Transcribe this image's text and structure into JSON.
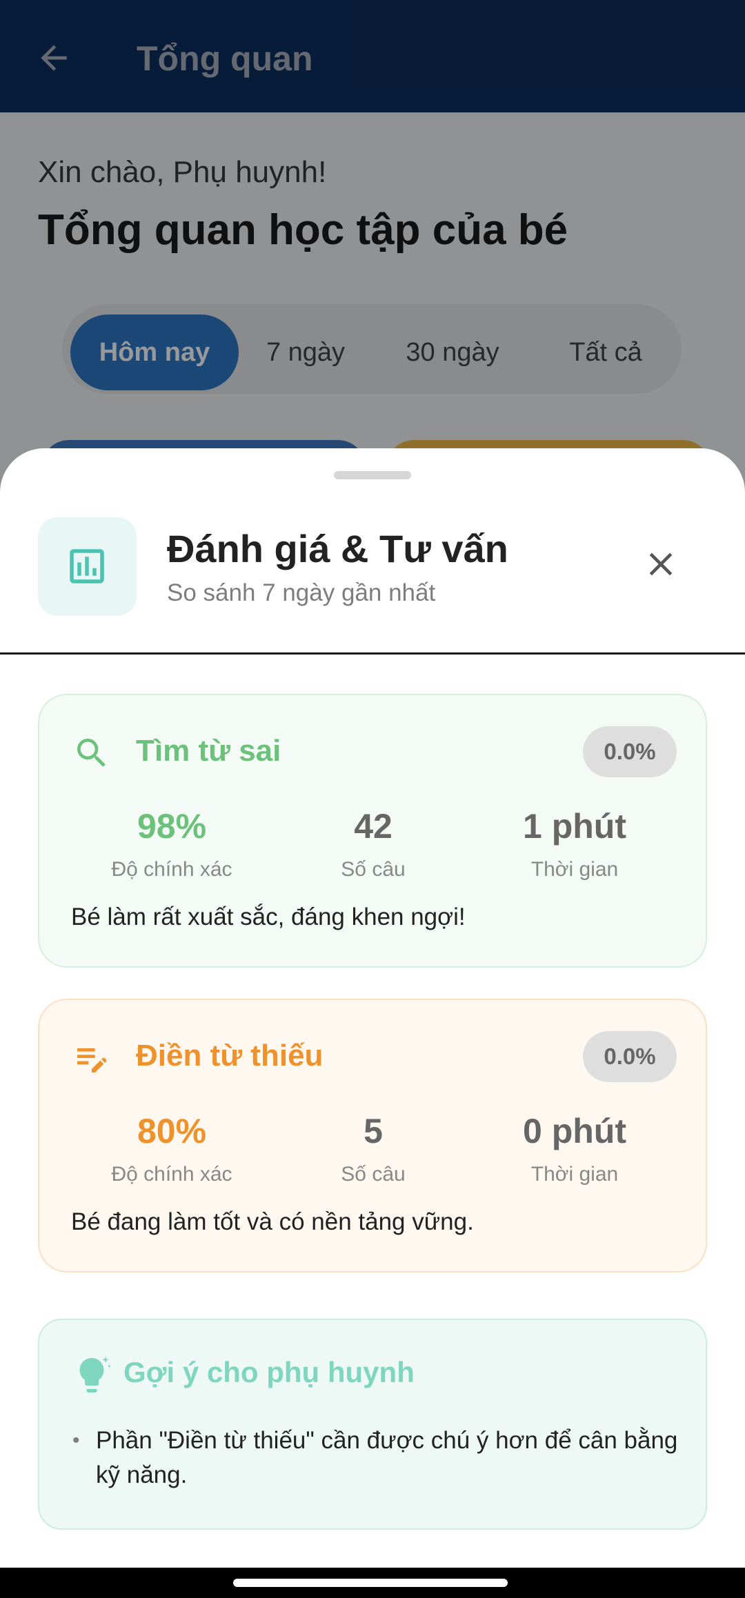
{
  "appbar": {
    "title": "Tổng quan"
  },
  "background": {
    "greeting": "Xin chào, Phụ huynh!",
    "heading": "Tổng quan học tập của bé",
    "ranges": [
      "Hôm nay",
      "7 ngày",
      "30 ngày",
      "Tất cả"
    ],
    "active_range": "Hôm nay"
  },
  "sheet": {
    "title": "Đánh giá & Tư vấn",
    "subtitle": "So sánh 7 ngày gần nhất",
    "cards": [
      {
        "title": "Tìm từ sai",
        "icon": "search-icon",
        "accent": "#6cc27a",
        "change": "0.0%",
        "accuracy": "98%",
        "accuracy_label": "Độ chính xác",
        "questions": "42",
        "questions_label": "Số câu",
        "time": "1 phút",
        "time_label": "Thời gian",
        "message": "Bé làm rất xuất sắc, đáng khen ngợi!"
      },
      {
        "title": "Điền từ thiếu",
        "icon": "edit-note-icon",
        "accent": "#f0922b",
        "change": "0.0%",
        "accuracy": "80%",
        "accuracy_label": "Độ chính xác",
        "questions": "5",
        "questions_label": "Số câu",
        "time": "0 phút",
        "time_label": "Thời gian",
        "message": "Bé đang làm tốt và có nền tảng vững."
      }
    ],
    "tips": {
      "title": "Gợi ý cho phụ huynh",
      "icon": "lightbulb-icon",
      "items": [
        "Phần \"Điền từ thiếu\" cần được chú ý hơn để cân bằng kỹ năng."
      ]
    }
  }
}
